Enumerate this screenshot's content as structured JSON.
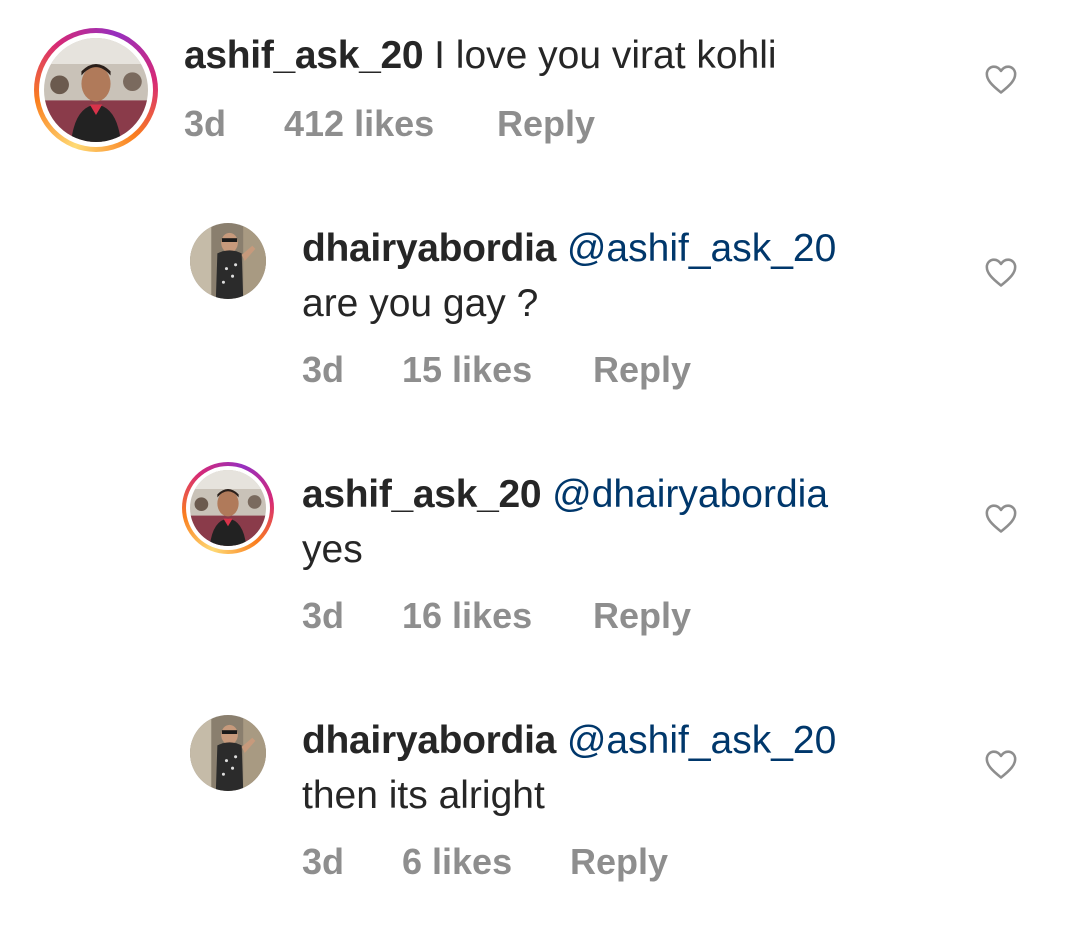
{
  "comments": [
    {
      "username": "ashif_ask_20",
      "mention": "",
      "text": "I love you virat kohli",
      "time": "3d",
      "likes": "412 likes",
      "reply": "Reply",
      "avatar": "ashif-avatar",
      "story_ring": true
    },
    {
      "username": "dhairyabordia",
      "mention": "@ashif_ask_20",
      "text": "are you gay ?",
      "time": "3d",
      "likes": "15 likes",
      "reply": "Reply",
      "avatar": "dhairya-avatar",
      "story_ring": false
    },
    {
      "username": "ashif_ask_20",
      "mention": "@dhairyabordia",
      "text": "yes",
      "time": "3d",
      "likes": "16 likes",
      "reply": "Reply",
      "avatar": "ashif-avatar",
      "story_ring": true
    },
    {
      "username": "dhairyabordia",
      "mention": "@ashif_ask_20",
      "text": "then its alright",
      "time": "3d",
      "likes": "6 likes",
      "reply": "Reply",
      "avatar": "dhairya-avatar",
      "story_ring": false
    }
  ],
  "icons": {
    "like": "heart-outline-icon"
  },
  "colors": {
    "mention": "#00376b",
    "meta": "#8e8e8e",
    "text": "#262626"
  }
}
